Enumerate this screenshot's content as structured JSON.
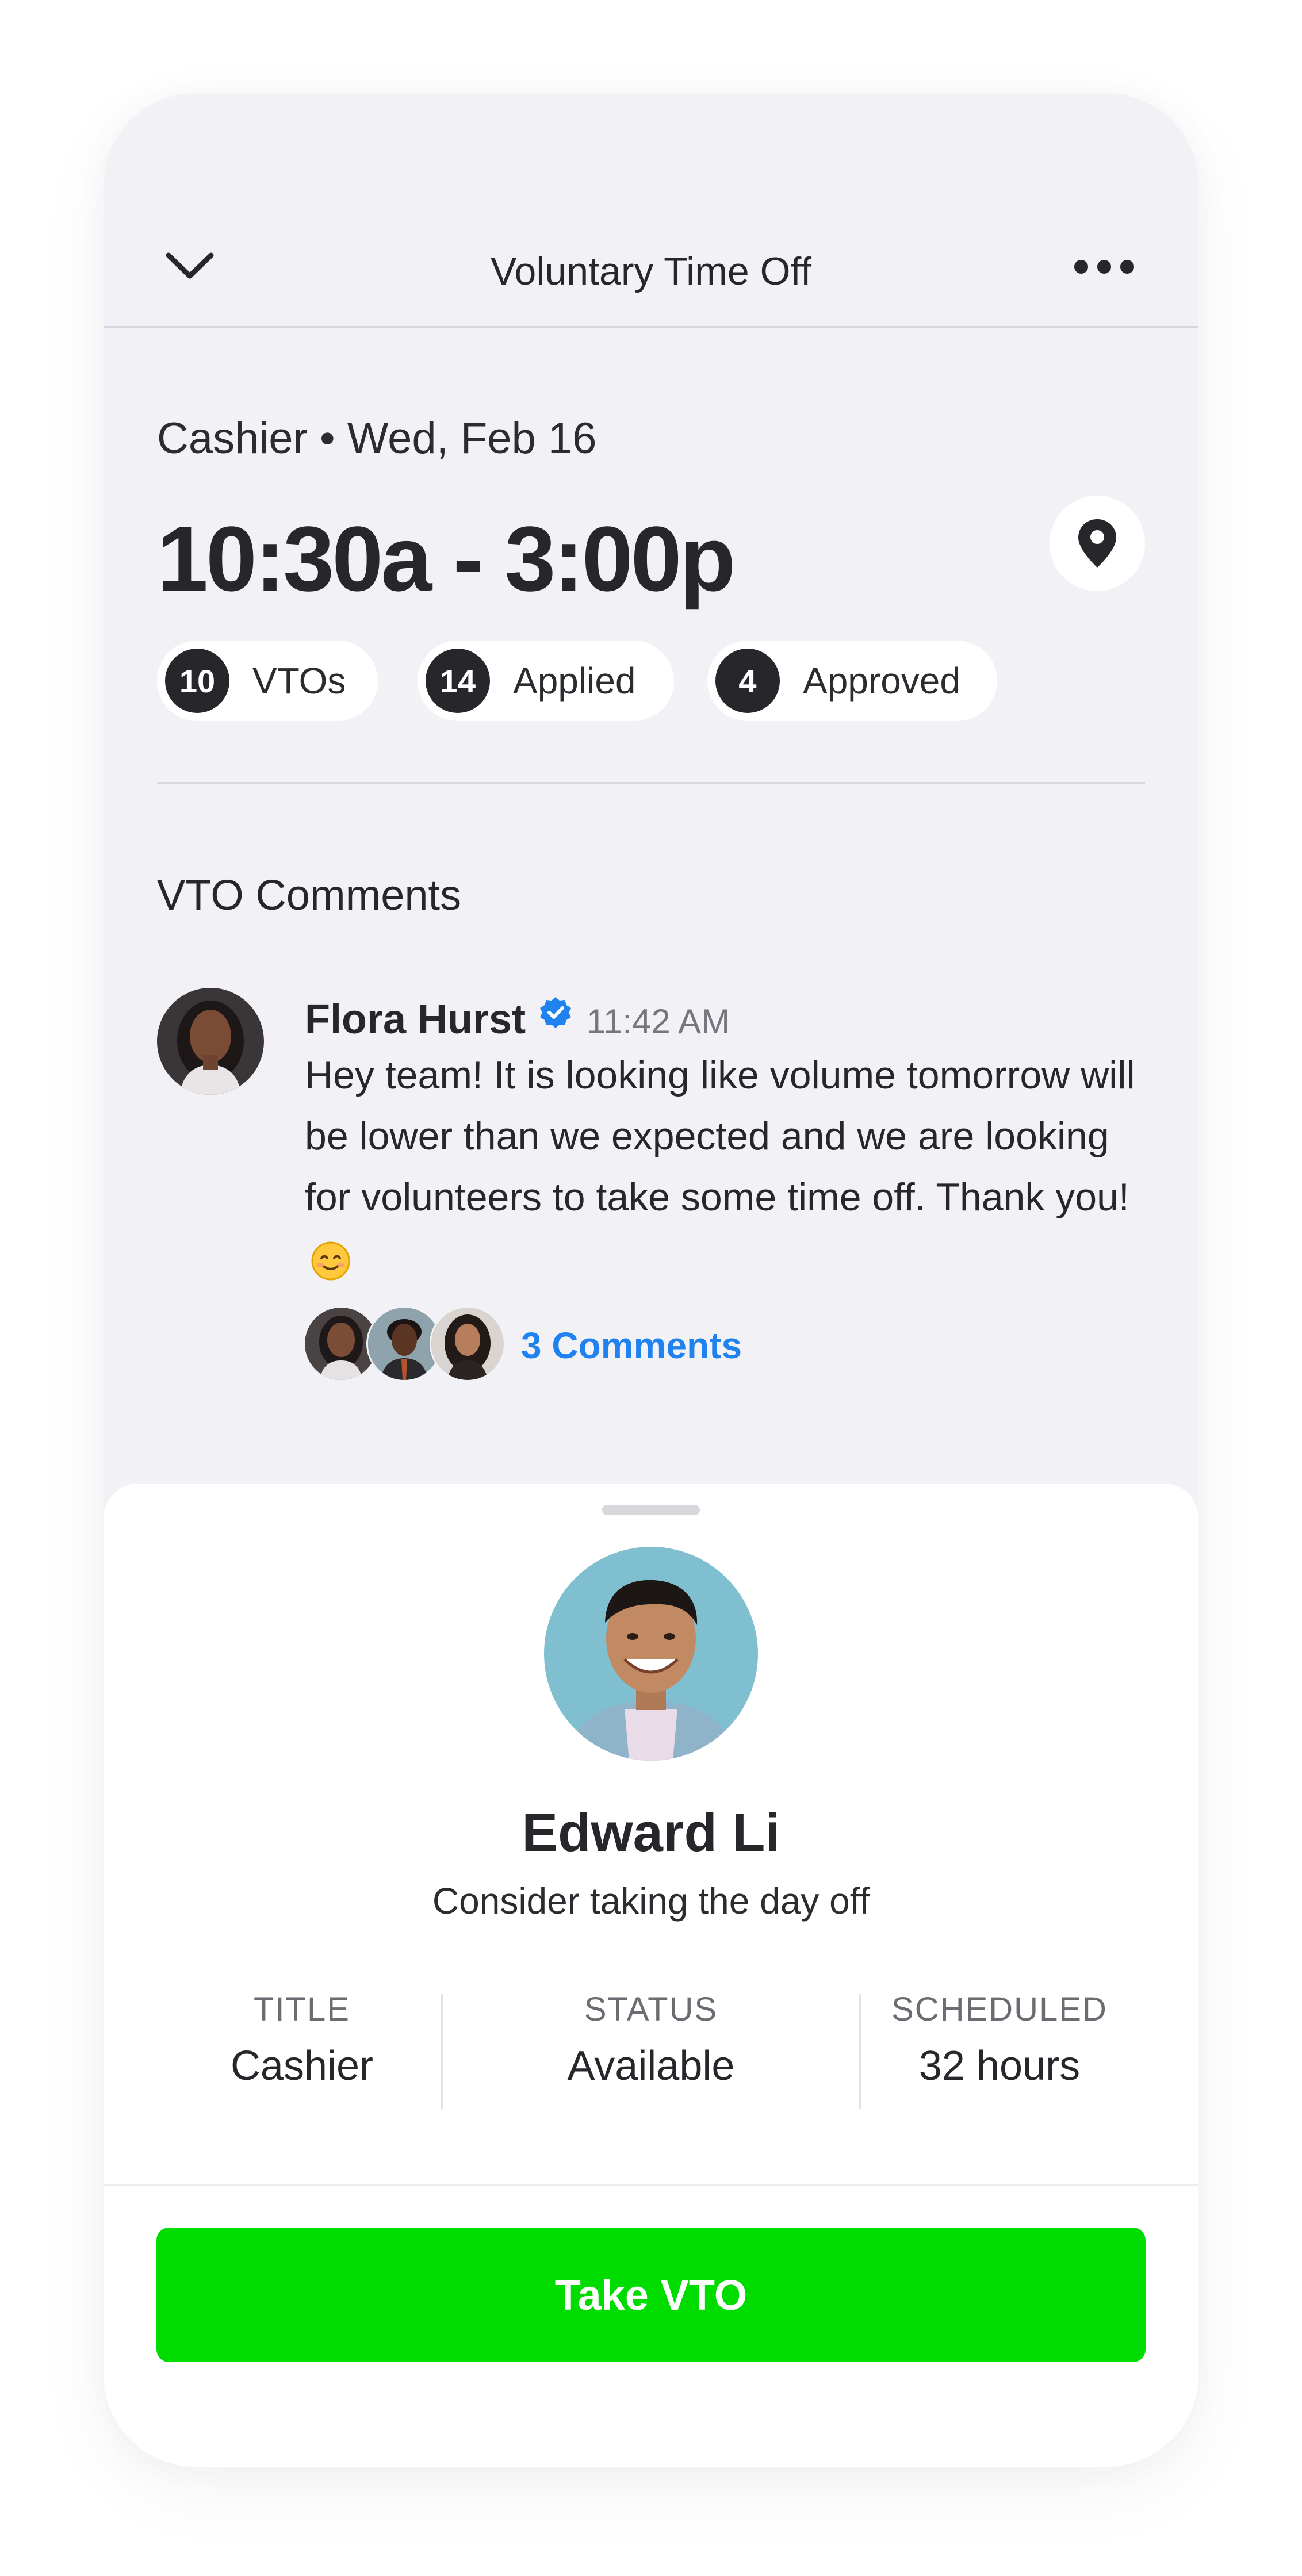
{
  "header": {
    "title": "Voluntary Time Off",
    "back_icon": "chevron-down-icon",
    "menu_icon": "more-horizontal-icon"
  },
  "shift": {
    "subtitle": "Cashier • Wed, Feb 16",
    "time_range": "10:30a - 3:00p",
    "location_icon": "map-pin-icon"
  },
  "counts": [
    {
      "value": "10",
      "label": "VTOs"
    },
    {
      "value": "14",
      "label": "Applied"
    },
    {
      "value": "4",
      "label": "Approved"
    }
  ],
  "comments_section": {
    "title": "VTO Comments",
    "comment": {
      "author": "Flora Hurst",
      "time": "11:42 AM",
      "message": "Hey team! It is looking like volume tomorrow will be lower than we expected and we are looking for volunteers to take some time off. Thank you!",
      "emoji": "smiling-face-emoji"
    },
    "replies_link": "3 Comments"
  },
  "profile": {
    "name": "Edward Li",
    "tagline": "Consider taking the day off",
    "stats": [
      {
        "label": "TITLE",
        "value": "Cashier"
      },
      {
        "label": "STATUS",
        "value": "Available"
      },
      {
        "label": "SCHEDULED",
        "value": "32 hours"
      }
    ]
  },
  "cta": {
    "label": "Take VTO"
  },
  "colors": {
    "primary_action": "#00DC00",
    "link": "#1F82EE",
    "background": "#F2F2F6",
    "verified": "#1F82EE"
  }
}
